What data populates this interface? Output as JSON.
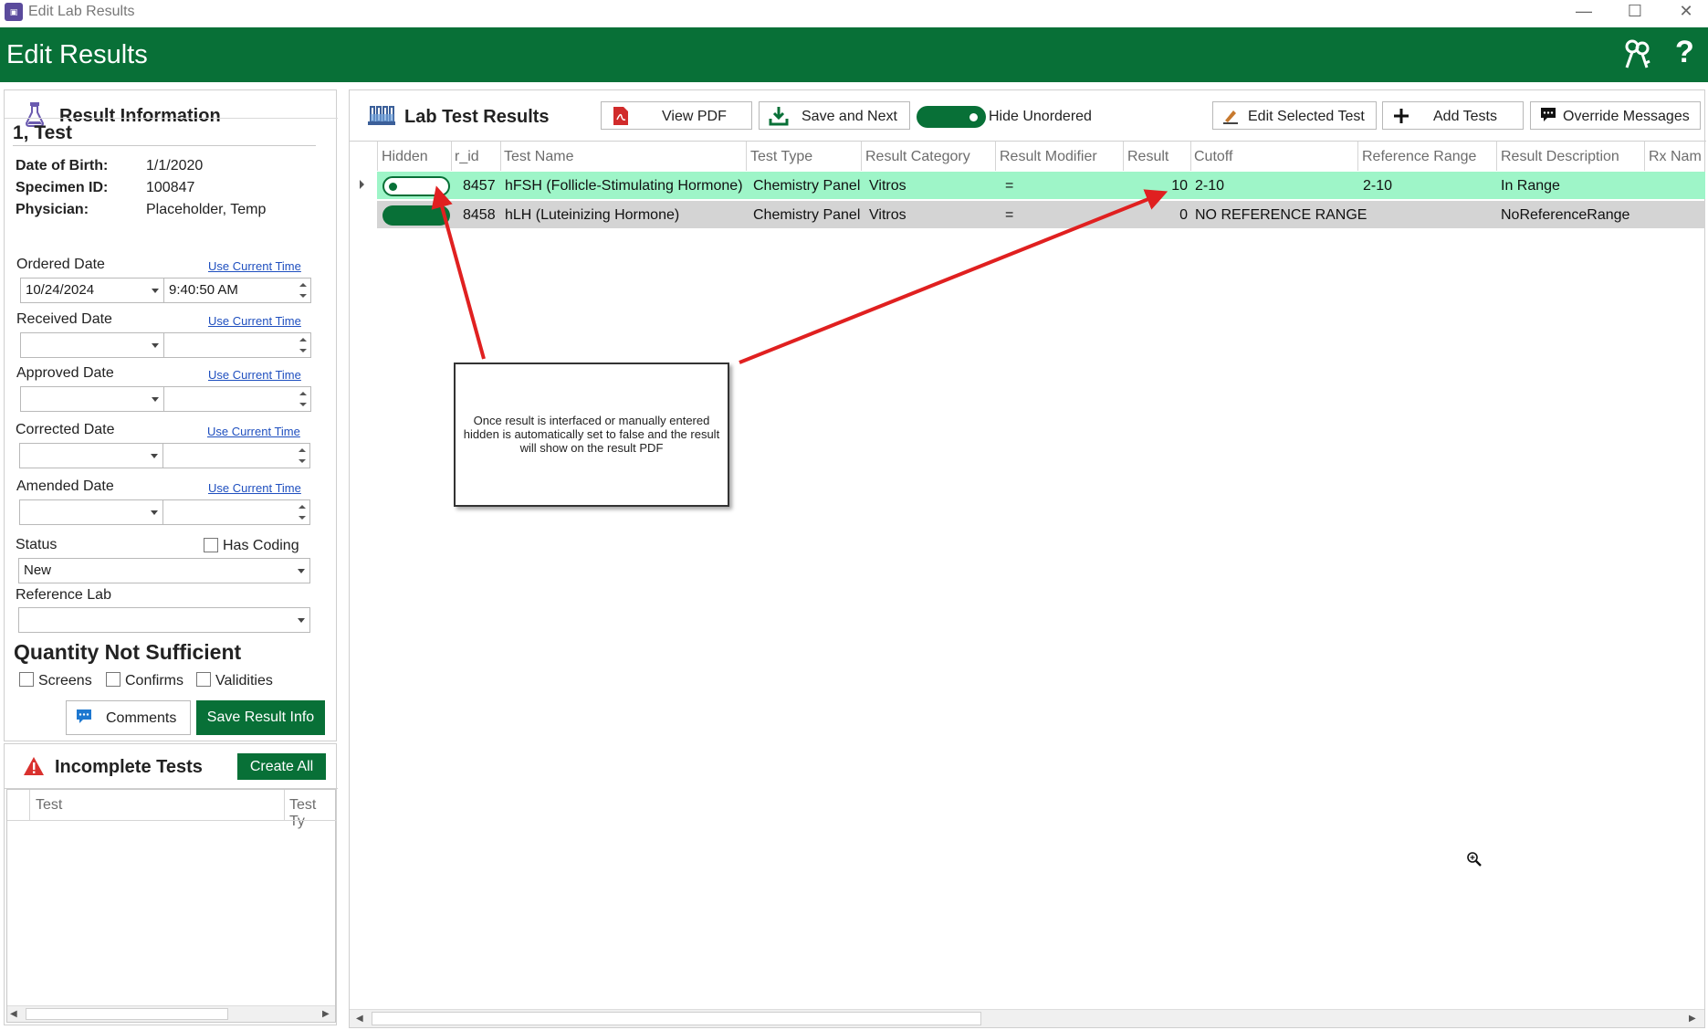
{
  "window": {
    "title": "Edit Lab Results",
    "app_icon": "app-logo-icon",
    "controls": [
      "minimize-icon",
      "maximize-icon",
      "close-icon"
    ]
  },
  "header": {
    "title": "Edit Results",
    "background": "#087037",
    "icons": [
      "keys-icon",
      "help-icon"
    ],
    "help_glyph": "?"
  },
  "result_info": {
    "title": "Result Information",
    "patient_name": "1, Test",
    "dob_label": "Date of Birth:",
    "dob_value": "1/1/2020",
    "specimen_label": "Specimen ID:",
    "specimen_value": "100847",
    "physician_label": "Physician:",
    "physician_value": "Placeholder, Temp",
    "use_current_time": "Use Current Time",
    "ordered_label": "Ordered Date",
    "ordered_date": "10/24/2024",
    "ordered_time": "9:40:50 AM",
    "received_label": "Received Date",
    "approved_label": "Approved Date",
    "corrected_label": "Corrected Date",
    "amended_label": "Amended Date",
    "status_label": "Status",
    "status_value": "New",
    "has_coding_label": "Has Coding",
    "reference_lab_label": "Reference Lab",
    "qns_title": "Quantity Not Sufficient",
    "qns_screens": "Screens",
    "qns_confirms": "Confirms",
    "qns_validities": "Validities",
    "comments_button": "Comments",
    "save_button": "Save Result Info"
  },
  "incomplete": {
    "title": "Incomplete Tests",
    "create_all": "Create All",
    "columns": [
      "Test",
      "Test Ty"
    ]
  },
  "lab_results": {
    "title": "Lab Test Results",
    "view_pdf": "View PDF",
    "save_next": "Save and Next",
    "hide_unordered": "Hide Unordered",
    "edit_selected": "Edit Selected Test",
    "add_tests": "Add Tests",
    "override_messages": "Override Messages",
    "columns": [
      "Hidden",
      "r_id",
      "Test Name",
      "Test Type",
      "Result Category",
      "Result Modifier",
      "Result",
      "Cutoff",
      "Reference Range",
      "Result Description",
      "Rx Nam"
    ],
    "rows": [
      {
        "hidden": false,
        "r_id": "8457",
        "test_name": "hFSH (Follicle-Stimulating Hormone)",
        "test_type": "Chemistry Panel",
        "category": "Vitros",
        "modifier": "=",
        "result": "10",
        "cutoff": "2-10",
        "reference_range": "2-10",
        "description": "In Range",
        "rx": ""
      },
      {
        "hidden": true,
        "r_id": "8458",
        "test_name": "hLH (Luteinizing Hormone)",
        "test_type": "Chemistry Panel",
        "category": "Vitros",
        "modifier": "=",
        "result": "0",
        "cutoff": "NO REFERENCE RANGE",
        "reference_range": "",
        "description": "NoReferenceRange",
        "rx": ""
      }
    ],
    "row1_color": "#9ef5c8",
    "row2_color": "#d4d4d4"
  },
  "annotation": {
    "text": "Once result is interfaced or manually entered hidden is automatically set to false and the result will show on the result PDF",
    "arrow_color": "#e02020"
  },
  "colors": {
    "accent_green": "#087037",
    "link_blue": "#1f4fbf"
  }
}
